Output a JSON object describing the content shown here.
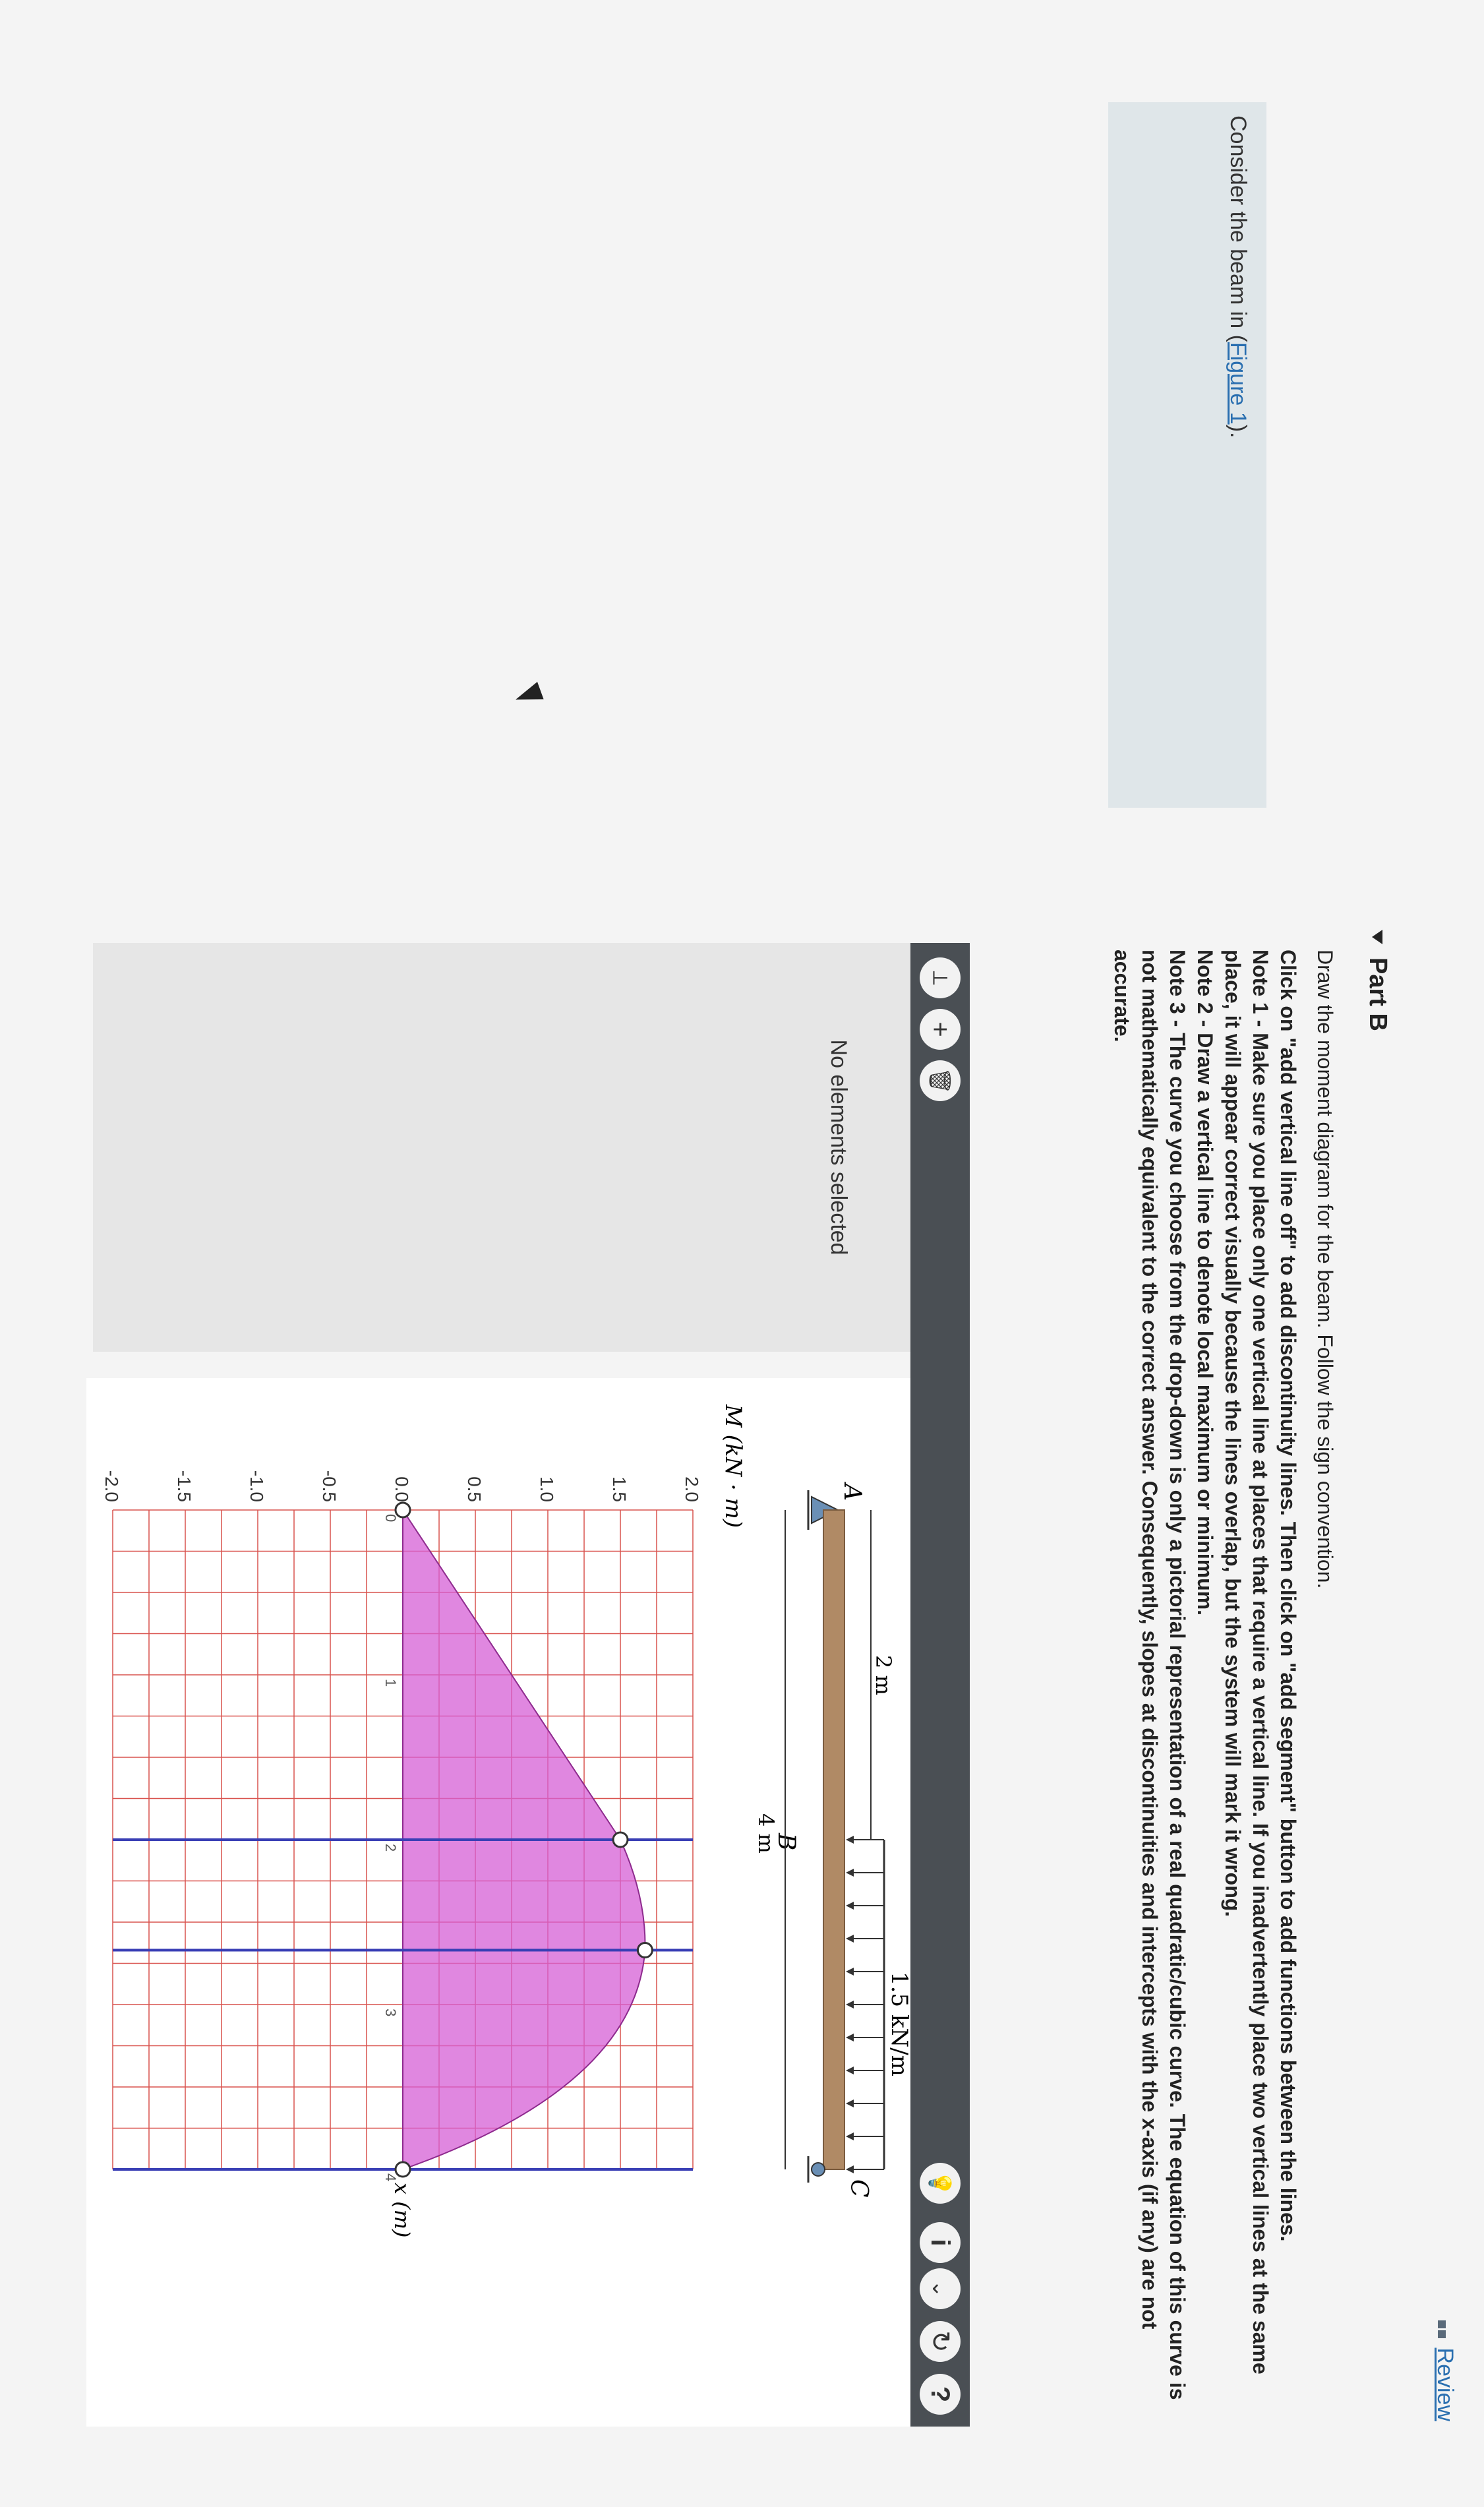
{
  "header": {
    "review_label": "Review"
  },
  "context": {
    "prefix": "Consider the beam in (",
    "link": "Figure 1",
    "suffix": ")."
  },
  "part": {
    "title": "Part B"
  },
  "instructions": {
    "line1": "Draw the moment diagram for the beam. Follow the sign convention.",
    "bold_lines": [
      "Click on \"add vertical line off\" to add discontinuity lines. Then click on \"add segment\" button to add functions between the lines.",
      "Note 1 - Make sure you place only one vertical line at places that require a vertical line. If you inadvertently place two vertical lines at the same place, it will appear correct visually because the lines overlap, but the system will mark it wrong.",
      "Note 2 - Draw a vertical line to denote local maximum or minimum.",
      "Note 3 - The curve you choose from the drop-down is only a pictorial representation of a real quadratic/cubic curve. The equation of this curve is not mathematically equivalent to the correct answer. Consequently, slopes at discontinuities and intercepts with the x-axis (if any) are not accurate."
    ]
  },
  "toolbar": {
    "left_icons": [
      "vertical-line-tool-icon",
      "add-icon",
      "trash-icon"
    ],
    "right_icons": [
      "hint-bulb-icon",
      "info-icon",
      "chevron-down-icon",
      "reset-icon",
      "help-icon"
    ],
    "add_glyph": "+",
    "info_glyph": "i",
    "chevron_glyph": "⌄",
    "reset_glyph": "↻",
    "help_glyph": "?",
    "trash_glyph": "🗑",
    "bulb_glyph": "💡",
    "tool_glyph": "⟂"
  },
  "left_panel": {
    "status": "No elements selected"
  },
  "beam_figure": {
    "load_label": "1.5 kN/m",
    "dim_2m": "2 m",
    "dim_4m": "4 m",
    "label_A": "A",
    "label_B": "B",
    "label_C": "C"
  },
  "chart_data": {
    "type": "line",
    "ylabel": "M (kN · m)",
    "xlabel": "x (m)",
    "xlim": [
      0,
      4
    ],
    "ylim": [
      -2.0,
      2.0
    ],
    "y_ticks": [
      "2.0",
      "1.5",
      "1.0",
      "0.5",
      "0.0",
      "-0.5",
      "-1.0",
      "-1.5",
      "-2.0"
    ],
    "x_ticks": [
      "0",
      "1",
      "2",
      "3",
      "4"
    ],
    "grid": true,
    "vertical_lines": [
      2.0,
      2.67,
      4.0
    ],
    "points": [
      {
        "x": 0.0,
        "y": 0.0
      },
      {
        "x": 2.0,
        "y": 1.5
      },
      {
        "x": 2.67,
        "y": 1.67
      },
      {
        "x": 4.0,
        "y": 0.0
      }
    ],
    "fill_color": "#d65fd6",
    "grid_color": "#d9534f",
    "vline_color": "#3a3fb5"
  }
}
